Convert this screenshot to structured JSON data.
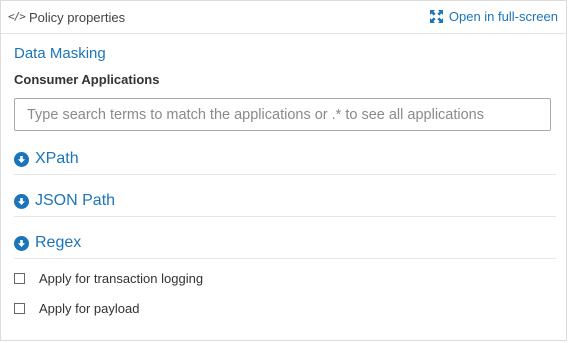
{
  "header": {
    "code_icon": "</>",
    "title": "Policy properties",
    "fullscreen_label": "Open in full-screen",
    "fullscreen_icon": "expand-arrows-icon"
  },
  "policy": {
    "section_title": "Data Masking",
    "consumer_label": "Consumer Applications",
    "search_placeholder": "Type search terms to match the applications or .* to see all applications",
    "search_value": ""
  },
  "accordions": [
    {
      "label": "XPath",
      "icon": "circle-arrow-down-icon"
    },
    {
      "label": "JSON Path",
      "icon": "circle-arrow-down-icon"
    },
    {
      "label": "Regex",
      "icon": "circle-arrow-down-icon"
    }
  ],
  "options": [
    {
      "label": "Apply for transaction logging",
      "checked": false
    },
    {
      "label": "Apply for payload",
      "checked": false
    }
  ],
  "colors": {
    "accent": "#1b75bb",
    "border": "#dcdcdc"
  }
}
